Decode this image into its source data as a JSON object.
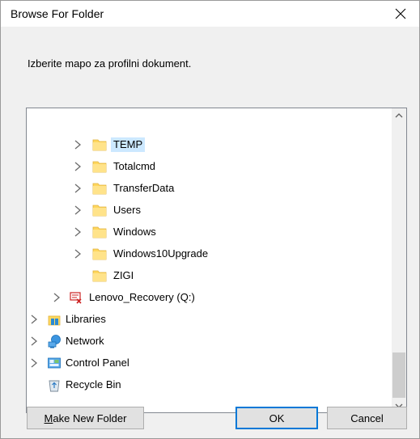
{
  "window": {
    "title": "Browse For Folder",
    "close_icon": "close-icon"
  },
  "prompt": "Izberite mapo za profilni dokument.",
  "tree": {
    "items": [
      {
        "label": "TEMP",
        "icon": "folder-icon",
        "expandable": true,
        "selected": true
      },
      {
        "label": "Totalcmd",
        "icon": "folder-icon",
        "expandable": true,
        "selected": false
      },
      {
        "label": "TransferData",
        "icon": "folder-icon",
        "expandable": true,
        "selected": false
      },
      {
        "label": "Users",
        "icon": "folder-icon",
        "expandable": true,
        "selected": false
      },
      {
        "label": "Windows",
        "icon": "folder-icon",
        "expandable": true,
        "selected": false
      },
      {
        "label": "Windows10Upgrade",
        "icon": "folder-icon",
        "expandable": true,
        "selected": false
      },
      {
        "label": "ZIGI",
        "icon": "folder-icon",
        "expandable": false,
        "selected": false
      },
      {
        "label": "Lenovo_Recovery (Q:)",
        "icon": "recovery-drive-icon",
        "expandable": true,
        "selected": false
      },
      {
        "label": "Libraries",
        "icon": "libraries-icon",
        "expandable": true,
        "selected": false
      },
      {
        "label": "Network",
        "icon": "network-icon",
        "expandable": true,
        "selected": false
      },
      {
        "label": "Control Panel",
        "icon": "control-panel-icon",
        "expandable": true,
        "selected": false
      },
      {
        "label": "Recycle Bin",
        "icon": "recycle-bin-icon",
        "expandable": false,
        "selected": false
      }
    ]
  },
  "buttons": {
    "make_new_folder_prefix": "M",
    "make_new_folder_rest": "ake New Folder",
    "ok": "OK",
    "cancel": "Cancel"
  },
  "colors": {
    "selection": "#cce8ff",
    "default_button_border": "#0078d7",
    "folder_yellow": "#ffd75e"
  }
}
